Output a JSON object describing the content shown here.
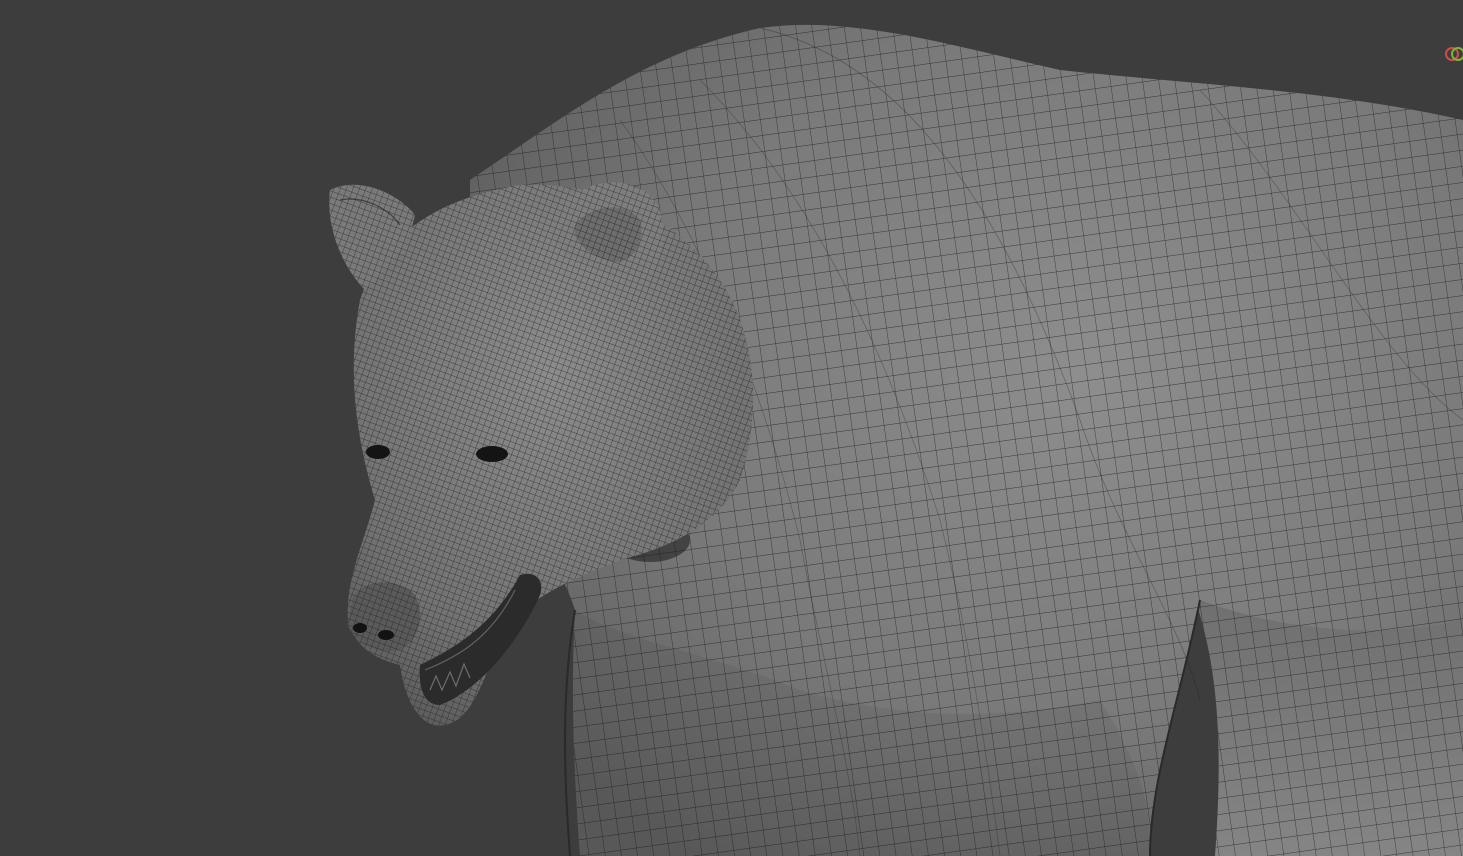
{
  "viewport": {
    "background_color": "#3d3d3d",
    "mesh_fill_color": "#7f7f7f",
    "wire_color": "#1c1c1c",
    "shading_mode": "solid-with-wireframe",
    "object": "bear-model"
  },
  "gizmo": {
    "axes": [
      {
        "axis": "x",
        "color": "#d24b4b"
      },
      {
        "axis": "y",
        "color": "#7fb33a"
      }
    ]
  }
}
